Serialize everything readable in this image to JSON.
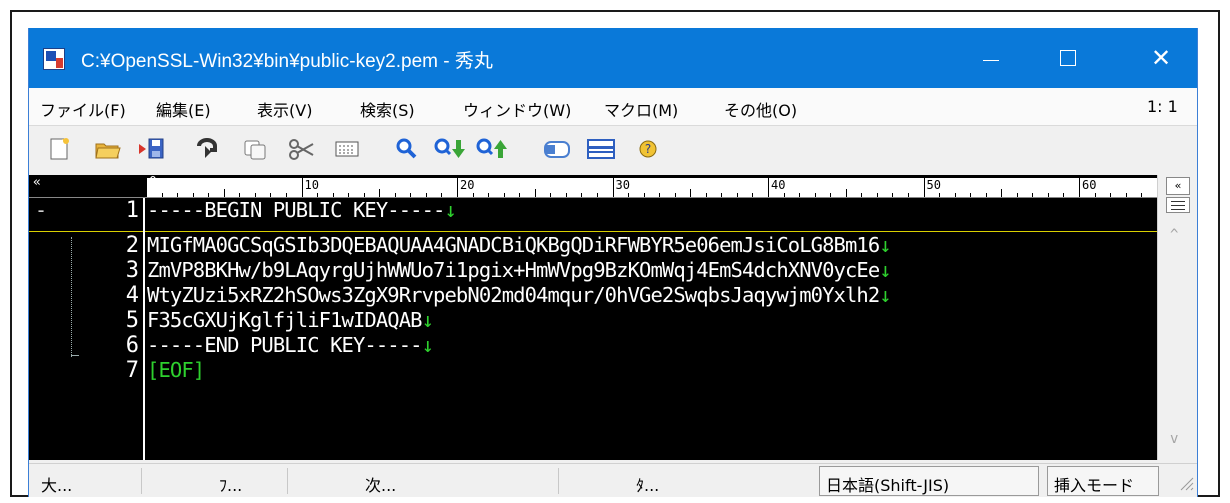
{
  "window": {
    "title": "C:¥OpenSSL-Win32¥bin¥public-key2.pem - 秀丸",
    "min_icon": "minimize-icon",
    "max_icon": "maximize-icon",
    "close_icon": "close-icon",
    "close_glyph": "✕"
  },
  "menu": {
    "items": [
      {
        "label": "ファイル(F)"
      },
      {
        "label": "編集(E)"
      },
      {
        "label": "表示(V)"
      },
      {
        "label": "検索(S)"
      },
      {
        "label": "ウィンドウ(W)"
      },
      {
        "label": "マクロ(M)"
      },
      {
        "label": "その他(O)"
      }
    ],
    "cursor_position": "1: 1"
  },
  "toolbar": {
    "icons": [
      "new-file-icon",
      "open-folder-icon",
      "save-icon",
      "undo-icon",
      "copy-icon",
      "cut-icon",
      "paste-icon",
      "find-icon",
      "find-next-icon",
      "find-prev-icon",
      "window-icon",
      "split-icon",
      "help-icon"
    ]
  },
  "ruler": {
    "left_mark": "«",
    "start": "0",
    "marks": [
      "10",
      "20",
      "30",
      "40",
      "50",
      "60"
    ]
  },
  "side_panel": {
    "top_button": "«",
    "scroll_up": "^",
    "scroll_down": "v"
  },
  "editor": {
    "lines": [
      {
        "num": "1",
        "text": "-----BEGIN PUBLIC KEY-----",
        "eol": "↓",
        "fold": "-"
      },
      {
        "num": "2",
        "text": "MIGfMA0GCSqGSIb3DQEBAQUAA4GNADCBiQKBgQDiRFWBYR5e06emJsiCoLG8Bm16",
        "eol": "↓",
        "fold": ""
      },
      {
        "num": "3",
        "text": "ZmVP8BKHw/b9LAqyrgUjhWWUo7i1pgix+HmWVpg9BzKOmWqj4EmS4dchXNV0ycEe",
        "eol": "↓",
        "fold": ""
      },
      {
        "num": "4",
        "text": "WtyZUzi5xRZ2hSOws3ZgX9RrvpebN02md04mqur/0hVGe2SwqbsJaqywjm0Yxlh2",
        "eol": "↓",
        "fold": ""
      },
      {
        "num": "5",
        "text": "F35cGXUjKglfjliF1wIDAQAB",
        "eol": "↓",
        "fold": ""
      },
      {
        "num": "6",
        "text": "-----END PUBLIC KEY-----",
        "eol": "↓",
        "fold": ""
      },
      {
        "num": "7",
        "text": "[EOF]",
        "eol": "",
        "fold": ""
      }
    ]
  },
  "statusbar": {
    "cells": [
      "大...",
      "ﾌ...",
      "次...",
      "ﾀ..."
    ],
    "encoding": "日本語(Shift-JIS)",
    "mode": "挿入モード"
  },
  "colors": {
    "titlebar": "#0a79d9",
    "editor_bg": "#000000",
    "eol": "#2ed12e",
    "cursor_line": "#d9d000"
  }
}
